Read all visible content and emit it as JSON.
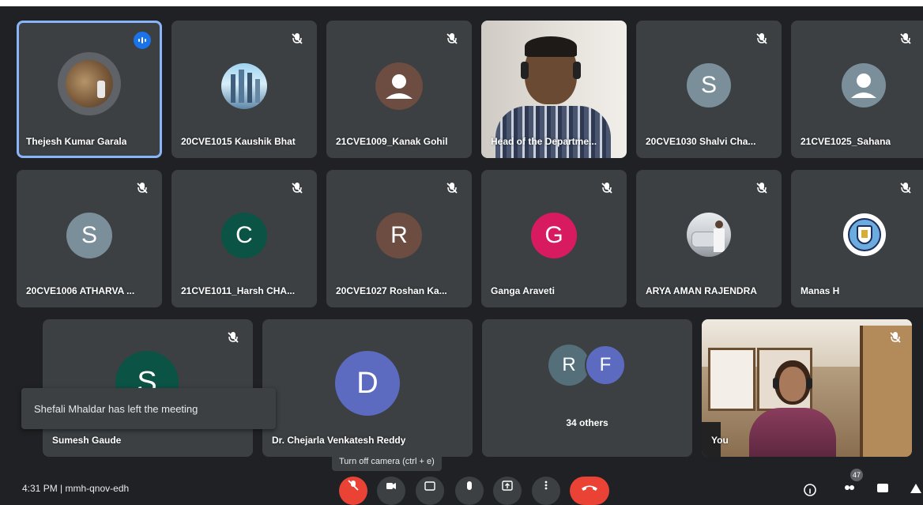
{
  "participants": [
    {
      "name": "Thejesh Kumar Garala"
    },
    {
      "name": "20CVE1015 Kaushik Bhat"
    },
    {
      "name": "21CVE1009_Kanak Gohil"
    },
    {
      "name": "Head of the Departme..."
    },
    {
      "name": "20CVE1030 Shalvi Cha..."
    },
    {
      "name": "21CVE1025_Sahana"
    },
    {
      "name": "20CVE1006 ATHARVA ...",
      "initial": "S"
    },
    {
      "name": "21CVE1011_Harsh CHA...",
      "initial": "C"
    },
    {
      "name": "20CVE1027 Roshan Ka...",
      "initial": "R"
    },
    {
      "name": "Ganga Araveti",
      "initial": "G"
    },
    {
      "name": "ARYA AMAN RAJENDRA"
    },
    {
      "name": "Manas H"
    },
    {
      "name": "Sumesh Gaude",
      "initial": "S"
    },
    {
      "name": "Dr. Chejarla Venkatesh Reddy",
      "initial": "D"
    },
    {
      "name": "You"
    }
  ],
  "shalvi_initial": "S",
  "others": {
    "label": "34 others",
    "initials": [
      "R",
      "F"
    ]
  },
  "toast": "Shefali Mhaldar has left the meeting",
  "tooltip": "Turn off camera (ctrl + e)",
  "meeting_info": "4:31 PM  |  mmh-qnov-edh",
  "participant_count": "47",
  "colors": {
    "background": "#202124",
    "tile": "#3c4043",
    "active_border": "#8ab4f8",
    "speaking": "#1a73e8",
    "red": "#ea4335",
    "avatar_gray": "#7b8f9a",
    "avatar_green": "#0b5345",
    "avatar_brown": "#6d4c41",
    "avatar_pink": "#d81b60",
    "avatar_purple": "#5c6bc0"
  }
}
